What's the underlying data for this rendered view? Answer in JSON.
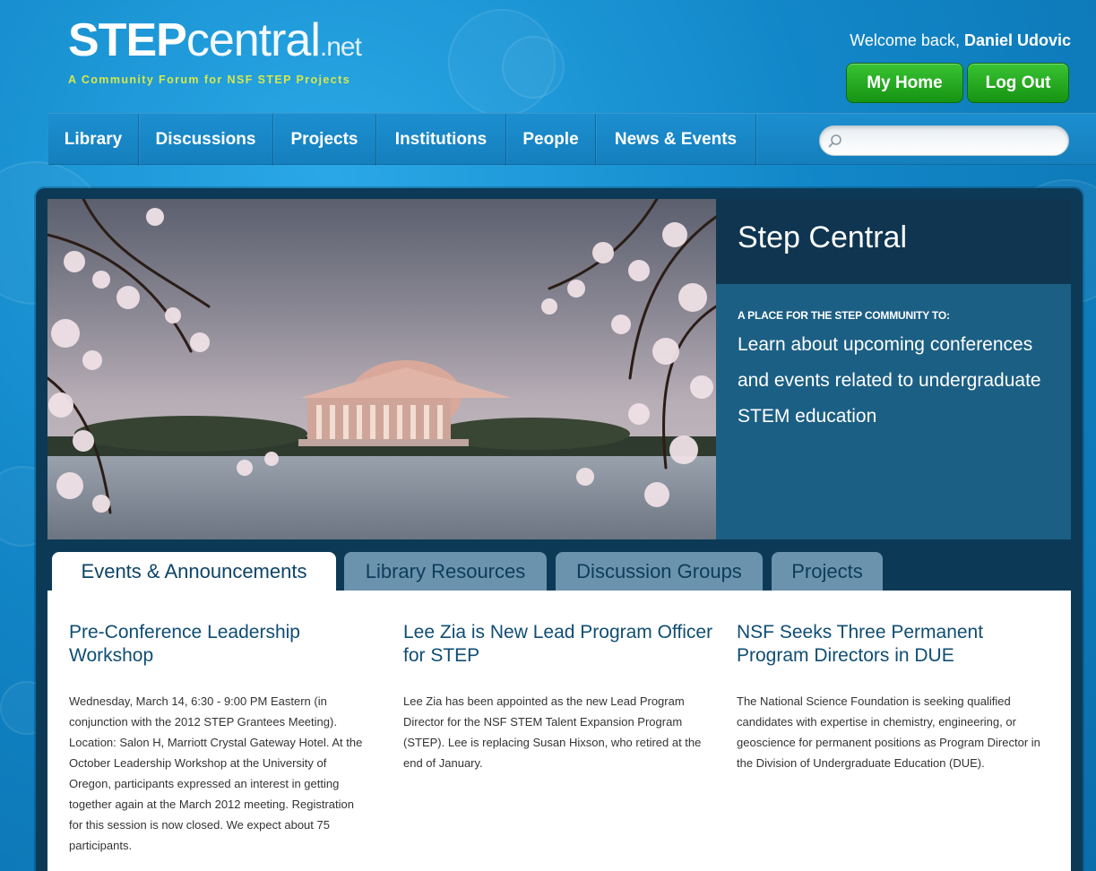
{
  "brand": {
    "logo_bold": "STEP",
    "logo_light": "central",
    "logo_tld": ".net",
    "tagline": "A Community Forum for NSF STEP Projects"
  },
  "user": {
    "welcome_prefix": "Welcome back,",
    "name": "Daniel Udovic",
    "home_button": "My Home",
    "logout_button": "Log Out"
  },
  "nav": {
    "items": [
      "Library",
      "Discussions",
      "Projects",
      "Institutions",
      "People",
      "News & Events"
    ],
    "search_placeholder": ""
  },
  "hero": {
    "title": "Step Central",
    "kicker": "A PLACE FOR THE STEP COMMUNITY TO:",
    "description": "Learn about upcoming conferences and events related to undergraduate STEM education"
  },
  "tabs": [
    "Events & Announcements",
    "Library Resources",
    "Discussion Groups",
    "Projects"
  ],
  "articles": [
    {
      "title": "Pre-Conference Leadership Workshop",
      "body": "Wednesday, March 14, 6:30 - 9:00 PM Eastern (in conjunction with the 2012 STEP Grantees Meeting). Location: Salon H, Marriott Crystal Gateway Hotel. At the October Leadership Workshop at the University of Oregon, participants expressed an interest in getting together again at the March 2012 meeting. Registration for this session is now closed. We expect about 75 participants."
    },
    {
      "title": "Lee Zia is New Lead Program Officer for STEP",
      "body": "Lee Zia has been appointed as the new Lead Program Director for the NSF STEM Talent Expansion Program (STEP). Lee is replacing Susan Hixson, who retired at the end of January."
    },
    {
      "title": "NSF Seeks Three Permanent Program Directors in DUE",
      "body": "The National Science Foundation is seeking qualified candidates with expertise in chemistry, engineering, or geoscience for permanent positions as Program Director in the Division of Undergraduate Education (DUE)."
    }
  ],
  "colors": {
    "background": "#1287c8",
    "button_green": "#169313",
    "panel_dark": "#0c3a56",
    "tagline_yellow": "#d7e84a",
    "heading_blue": "#0f4d74"
  }
}
